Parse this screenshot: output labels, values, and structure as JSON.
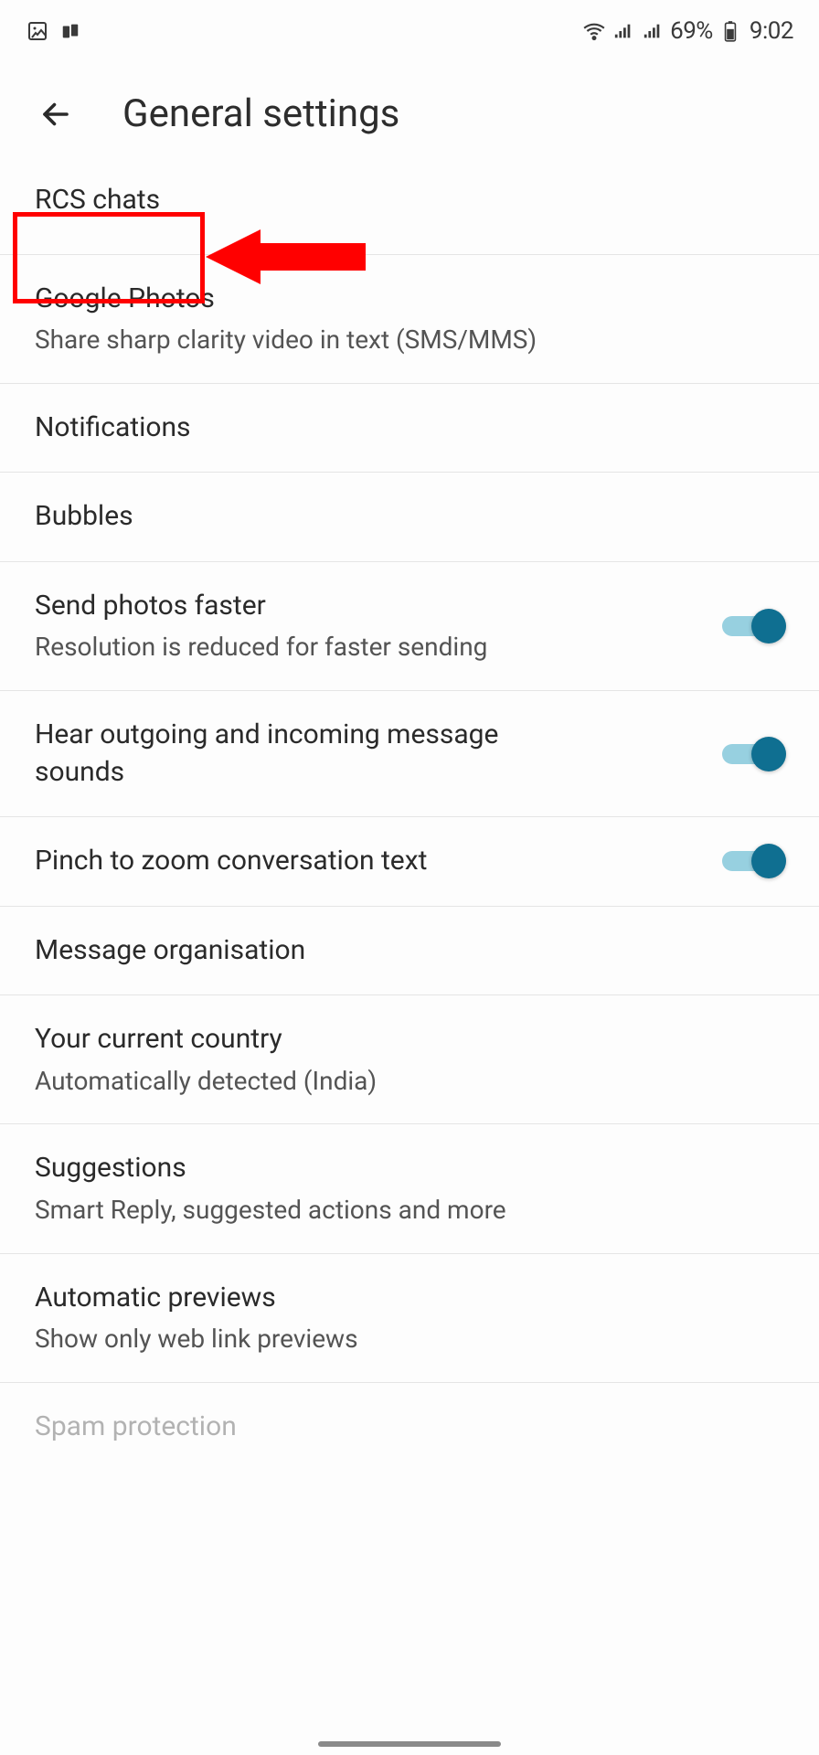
{
  "status": {
    "battery": "69%",
    "time": "9:02"
  },
  "header": {
    "title": "General settings"
  },
  "settings": [
    {
      "title": "RCS chats",
      "subtitle": null,
      "toggle": false
    },
    {
      "title": "Google Photos",
      "subtitle": "Share sharp clarity video in text (SMS/MMS)",
      "toggle": false
    },
    {
      "title": "Notifications",
      "subtitle": null,
      "toggle": false
    },
    {
      "title": "Bubbles",
      "subtitle": null,
      "toggle": false
    },
    {
      "title": "Send photos faster",
      "subtitle": "Resolution is reduced for faster sending",
      "toggle": true
    },
    {
      "title": "Hear outgoing and incoming message sounds",
      "subtitle": null,
      "toggle": true
    },
    {
      "title": "Pinch to zoom conversation text",
      "subtitle": null,
      "toggle": true
    },
    {
      "title": "Message organisation",
      "subtitle": null,
      "toggle": false
    },
    {
      "title": "Your current country",
      "subtitle": "Automatically detected (India)",
      "toggle": false
    },
    {
      "title": "Suggestions",
      "subtitle": "Smart Reply, suggested actions and more",
      "toggle": false
    },
    {
      "title": "Automatic previews",
      "subtitle": "Show only web link previews",
      "toggle": false
    },
    {
      "title": "Spam protection",
      "subtitle": null,
      "toggle": false
    }
  ],
  "annotation": {
    "highlight_target": "RCS chats"
  }
}
